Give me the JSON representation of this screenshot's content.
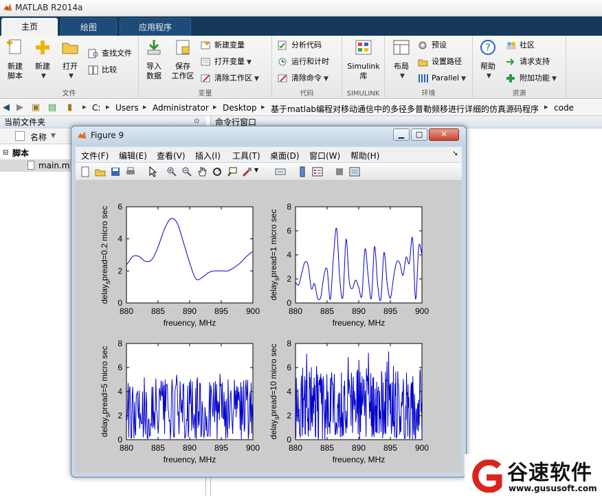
{
  "window": {
    "title": "MATLAB R2014a"
  },
  "ribbon_tabs": [
    "主页",
    "绘图",
    "应用程序"
  ],
  "ribbon": {
    "file_group": {
      "label": "文件",
      "new_script": "新建\n脚本",
      "new": "新建",
      "open": "打开",
      "find_files": "查找文件",
      "compare": "比较"
    },
    "variable_group": {
      "label": "变量",
      "import": "导入\n数据",
      "save_ws": "保存\n工作区",
      "new_var": "新建变量",
      "open_var": "打开变量",
      "clear_ws": "清除工作区"
    },
    "code_group": {
      "label": "代码",
      "analyze": "分析代码",
      "run_time": "运行和计时",
      "clear_cmd": "清除命令"
    },
    "simulink_group": {
      "label": "SIMULINK",
      "simulink": "Simulink\n库"
    },
    "env_group": {
      "label": "环境",
      "layout": "布局",
      "prefs": "预设",
      "set_path": "设置路径",
      "parallel": "Parallel"
    },
    "resources_group": {
      "label": "资源",
      "help": "帮助",
      "community": "社区",
      "support": "请求支持",
      "addons": "附加功能"
    }
  },
  "address": {
    "crumbs": [
      "C:",
      "Users",
      "Administrator",
      "Desktop",
      "基于matlab编程对移动通信中的多径多普勒频移进行详细的仿真源码程序",
      "code"
    ]
  },
  "current_folder": {
    "title": "当前文件夹",
    "column": "名称",
    "group": "脚本",
    "file": "main.m"
  },
  "command_window": {
    "title": "命令行窗口"
  },
  "figure": {
    "title": "Figure 9",
    "menu": [
      "文件(F)",
      "编辑(E)",
      "查看(V)",
      "插入(I)",
      "工具(T)",
      "桌面(D)",
      "窗口(W)",
      "帮助(H)"
    ]
  },
  "chart_data": [
    {
      "type": "line",
      "ylabel": "delay_spread=0.2 micro sec",
      "xlabel": "freuency, MHz",
      "xlim": [
        880,
        900
      ],
      "ylim": [
        0,
        6
      ],
      "xticks": [
        880,
        885,
        890,
        895,
        900
      ],
      "yticks": [
        0,
        2,
        4,
        6
      ],
      "x": [
        880,
        881,
        882,
        883,
        884,
        885,
        886,
        887,
        888,
        889,
        890,
        891,
        892,
        893,
        894,
        895,
        896,
        897,
        898,
        899,
        900
      ],
      "y": [
        2.4,
        2.9,
        2.9,
        2.6,
        2.7,
        3.5,
        4.6,
        5.25,
        5.0,
        3.8,
        2.5,
        1.5,
        1.6,
        1.9,
        2.0,
        2.0,
        2.0,
        2.2,
        2.5,
        2.9,
        3.2
      ]
    },
    {
      "type": "line",
      "ylabel": "delay_spread=1 micro sec",
      "xlabel": "freuency, MHz",
      "xlim": [
        880,
        900
      ],
      "ylim": [
        0,
        8
      ],
      "xticks": [
        880,
        885,
        890,
        895,
        900
      ],
      "yticks": [
        0,
        2,
        4,
        6,
        8
      ],
      "x": [
        880,
        880.5,
        881,
        881.5,
        882,
        882.5,
        883,
        883.5,
        884,
        884.5,
        885,
        885.5,
        886,
        886.5,
        887,
        887.5,
        888,
        888.5,
        889,
        889.5,
        890,
        890.5,
        891,
        891.5,
        892,
        892.5,
        893,
        893.5,
        894,
        894.5,
        895,
        895.5,
        896,
        896.5,
        897,
        897.5,
        898,
        898.5,
        899,
        899.5,
        900
      ],
      "y": [
        1.7,
        1.5,
        2.5,
        3.4,
        3.1,
        1.2,
        1.6,
        0.4,
        0.5,
        2.3,
        2.8,
        0.3,
        3.8,
        6.2,
        2.0,
        0.5,
        5.3,
        1.8,
        1.2,
        1.9,
        1.3,
        0.6,
        4.5,
        2.2,
        0.4,
        4.7,
        1.5,
        0.3,
        4.2,
        1.6,
        0.4,
        2.1,
        3.4,
        3.3,
        2.3,
        3.8,
        3.3,
        5.4,
        0.3,
        4.7,
        4.1
      ]
    },
    {
      "type": "line",
      "ylabel": "delay_spread=5 micro sec",
      "xlabel": "freuency, MHz",
      "xlim": [
        880,
        900
      ],
      "ylim": [
        0,
        8
      ],
      "xticks": [
        880,
        885,
        890,
        895,
        900
      ],
      "yticks": [
        0,
        2,
        4,
        6,
        8
      ],
      "noisy": true,
      "points": 220,
      "y_mean": 2.3,
      "y_max": 5.5
    },
    {
      "type": "line",
      "ylabel": "delay_spread=10 micro sec",
      "xlabel": "freuency, MHz",
      "xlim": [
        880,
        900
      ],
      "ylim": [
        0,
        8
      ],
      "xticks": [
        880,
        885,
        890,
        895,
        900
      ],
      "yticks": [
        0,
        2,
        4,
        6,
        8
      ],
      "noisy": true,
      "points": 320,
      "y_mean": 2.6,
      "y_max": 7.5
    }
  ],
  "watermark": {
    "brand": "谷速软件",
    "url": "www.gususoft.com"
  },
  "colors": {
    "tab_bar": "#15395c",
    "plot_line": "#0000cc",
    "figure_bg": "#cccccc",
    "brand_red": "#d9261c"
  }
}
